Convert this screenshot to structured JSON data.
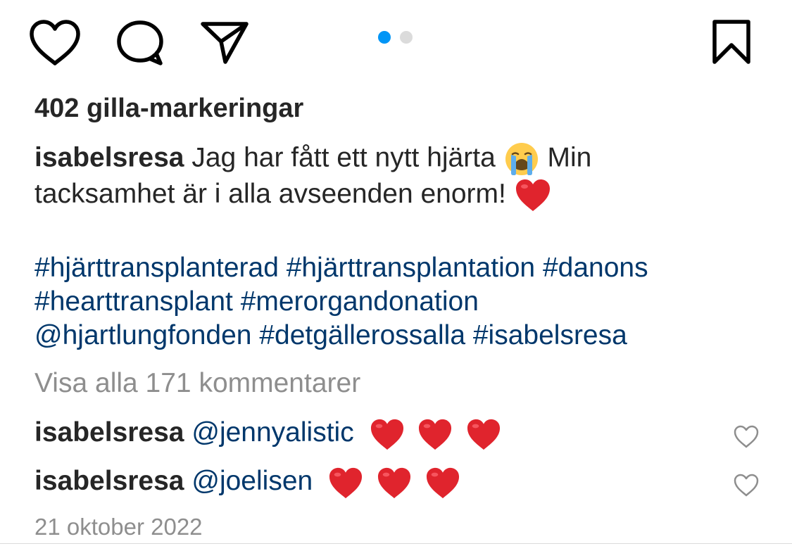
{
  "actions": {
    "like_icon": "heart-outline-icon",
    "comment_icon": "speech-bubble-icon",
    "share_icon": "paper-plane-icon",
    "save_icon": "bookmark-icon"
  },
  "carousel": {
    "total": 2,
    "active_index": 1,
    "active_color": "#0095f6",
    "inactive_color": "#dbdbdb"
  },
  "likes_text": "402 gilla-markeringar",
  "caption": {
    "username": "isabelsresa",
    "line1_text": "Jag har fått ett nytt hjärta",
    "line1_emoji": "loudly-crying-face",
    "line1_after": "Min",
    "line2_text": "tacksamhet är i alla avseenden enorm!",
    "line2_emoji": "red-heart"
  },
  "hashtags": {
    "line1": "#hjärttransplanterad #hjärttransplantation #danons",
    "line2": "#hearttransplant #merorgandonation",
    "line3_mention": "@hjartlungfonden",
    "line3_tags": "#detgällerossalla #isabelsresa"
  },
  "view_all_comments": "Visa alla 171 kommentarer",
  "comments": [
    {
      "username": "isabelsresa",
      "mention": "@jennyalistic",
      "hearts": 3
    },
    {
      "username": "isabelsresa",
      "mention": "@joelisen",
      "hearts": 3
    }
  ],
  "timestamp": "21 oktober 2022",
  "colors": {
    "text": "#262626",
    "link": "#00376b",
    "secondary": "#8e8e8e",
    "heart_red": "#e0242d"
  }
}
